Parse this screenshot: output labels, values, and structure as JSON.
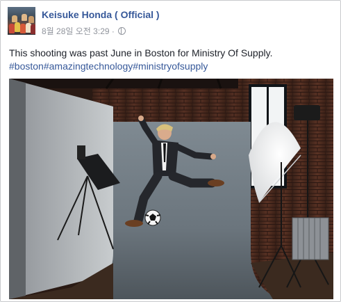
{
  "post": {
    "page_name": "Keisuke Honda ( Official )",
    "timestamp": "8월 28일 오전 3:29",
    "separator": "·",
    "privacy_icon": "globe-icon",
    "text_line1": "This shooting was past June in Boston for Ministry Of Supply.",
    "hashtags": [
      "#boston",
      "#amazingtechnology",
      "#ministryofsupply"
    ]
  },
  "photo": {
    "subject": "man in suit kicking a soccer ball in a photo studio"
  },
  "colors": {
    "link": "#365899",
    "text": "#1d2129",
    "meta": "#90949c",
    "border": "#c7c9cc"
  }
}
